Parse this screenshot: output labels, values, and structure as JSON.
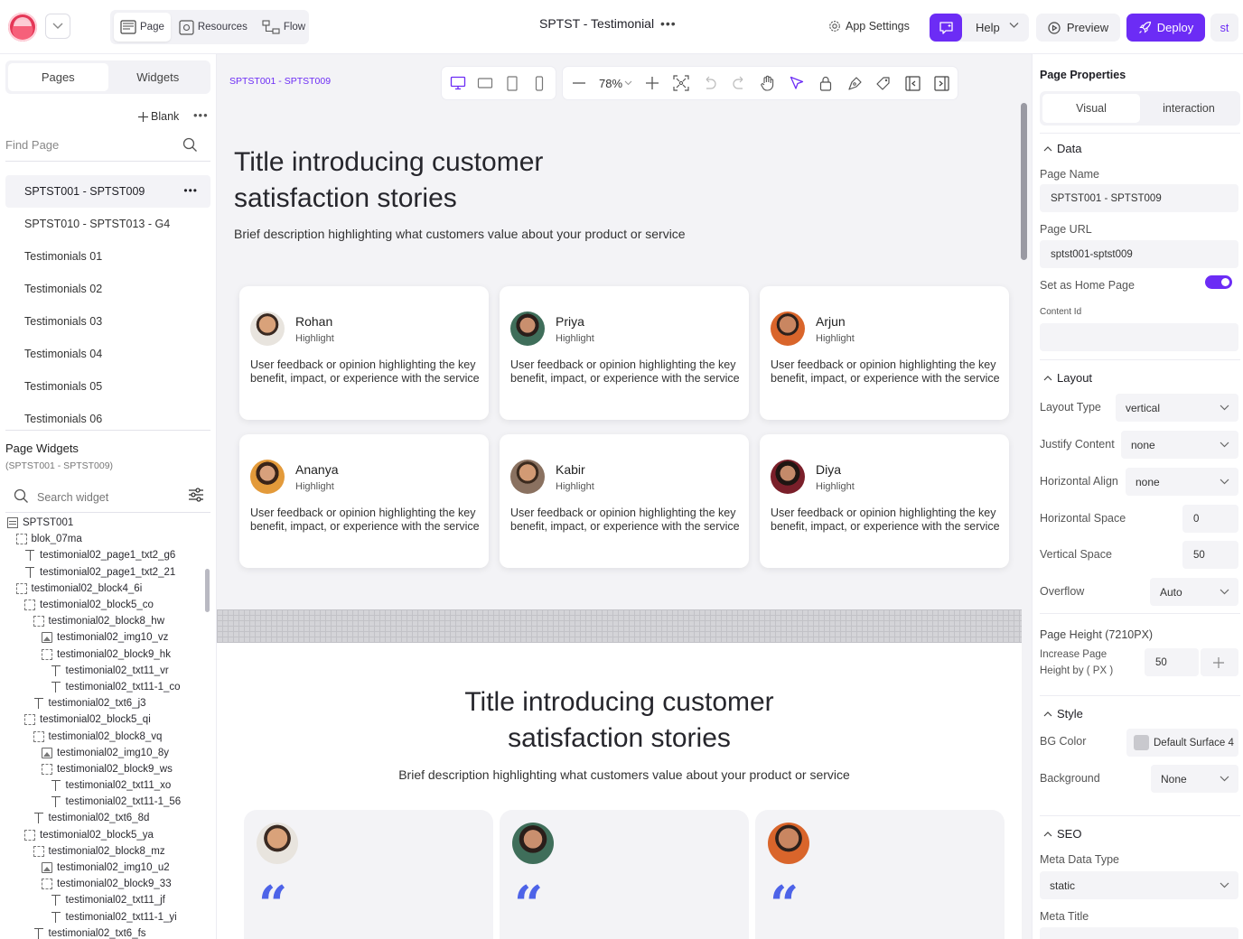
{
  "topbar": {
    "modes": [
      {
        "label": "Page",
        "active": true
      },
      {
        "label": "Resources",
        "active": false
      },
      {
        "label": "Flow",
        "active": false
      }
    ],
    "app_title": "SPTST - Testimonial",
    "title_menu": "•••",
    "app_settings": "App Settings",
    "help": "Help",
    "preview": "Preview",
    "deploy": "Deploy",
    "user_initials": "st",
    "accent_color": "#6c2cf5"
  },
  "left": {
    "tabs": [
      "Pages",
      "Widgets"
    ],
    "active_tab": "Pages",
    "blank_label": "Blank",
    "more": "•••",
    "find_placeholder": "Find Page",
    "pages": [
      {
        "label": "SPTST001 - SPTST009",
        "active": true
      },
      {
        "label": "SPTST010 - SPTST013 - G4",
        "active": false
      },
      {
        "label": "Testimonials 01",
        "active": false
      },
      {
        "label": "Testimonials 02",
        "active": false
      },
      {
        "label": "Testimonials 03",
        "active": false
      },
      {
        "label": "Testimonials 04",
        "active": false
      },
      {
        "label": "Testimonials 05",
        "active": false
      },
      {
        "label": "Testimonials 06",
        "active": false
      }
    ],
    "page_widgets_title": "Page Widgets",
    "page_widgets_sub": "(SPTST001 - SPTST009)",
    "search_widget": "Search widget",
    "tree": [
      {
        "label": "SPTST001",
        "icon": "page",
        "depth": 0
      },
      {
        "label": "blok_07ma",
        "icon": "box",
        "depth": 1
      },
      {
        "label": "testimonial02_page1_txt2_g6",
        "icon": "text",
        "depth": 2
      },
      {
        "label": "testimonial02_page1_txt2_21",
        "icon": "text",
        "depth": 2
      },
      {
        "label": "testimonial02_block4_6i",
        "icon": "box",
        "depth": 1
      },
      {
        "label": "testimonial02_block5_co",
        "icon": "box",
        "depth": 2
      },
      {
        "label": "testimonial02_block8_hw",
        "icon": "box",
        "depth": 3
      },
      {
        "label": "testimonial02_img10_vz",
        "icon": "img",
        "depth": 4
      },
      {
        "label": "testimonial02_block9_hk",
        "icon": "box",
        "depth": 4
      },
      {
        "label": "testimonial02_txt11_vr",
        "icon": "text",
        "depth": 5
      },
      {
        "label": "testimonial02_txt11-1_co",
        "icon": "text",
        "depth": 5
      },
      {
        "label": "testimonial02_txt6_j3",
        "icon": "text",
        "depth": 3
      },
      {
        "label": "testimonial02_block5_qi",
        "icon": "box",
        "depth": 2
      },
      {
        "label": "testimonial02_block8_vq",
        "icon": "box",
        "depth": 3
      },
      {
        "label": "testimonial02_img10_8y",
        "icon": "img",
        "depth": 4
      },
      {
        "label": "testimonial02_block9_ws",
        "icon": "box",
        "depth": 4
      },
      {
        "label": "testimonial02_txt11_xo",
        "icon": "text",
        "depth": 5
      },
      {
        "label": "testimonial02_txt11-1_56",
        "icon": "text",
        "depth": 5
      },
      {
        "label": "testimonial02_txt6_8d",
        "icon": "text",
        "depth": 3
      },
      {
        "label": "testimonial02_block5_ya",
        "icon": "box",
        "depth": 2
      },
      {
        "label": "testimonial02_block8_mz",
        "icon": "box",
        "depth": 3
      },
      {
        "label": "testimonial02_img10_u2",
        "icon": "img",
        "depth": 4
      },
      {
        "label": "testimonial02_block9_33",
        "icon": "box",
        "depth": 4
      },
      {
        "label": "testimonial02_txt11_jf",
        "icon": "text",
        "depth": 5
      },
      {
        "label": "testimonial02_txt11-1_yi",
        "icon": "text",
        "depth": 5
      },
      {
        "label": "testimonial02_txt6_fs",
        "icon": "text",
        "depth": 3
      }
    ]
  },
  "canvas": {
    "page_name": "SPTST001 - SPTST009",
    "zoom": "78%",
    "section1": {
      "title": "Title introducing customer satisfaction stories",
      "description": "Brief description highlighting what customers value about your product or service",
      "cards": [
        {
          "name": "Rohan",
          "highlight": "Highlight",
          "feedback": "User feedback or opinion highlighting the key benefit, impact, or experience with the service"
        },
        {
          "name": "Priya",
          "highlight": "Highlight",
          "feedback": "User feedback or opinion highlighting the key benefit, impact, or experience with the service"
        },
        {
          "name": "Arjun",
          "highlight": "Highlight",
          "feedback": "User feedback or opinion highlighting the key benefit, impact, or experience with the service"
        },
        {
          "name": "Ananya",
          "highlight": "Highlight",
          "feedback": "User feedback or opinion highlighting the key benefit, impact, or experience with the service"
        },
        {
          "name": "Kabir",
          "highlight": "Highlight",
          "feedback": "User feedback or opinion highlighting the key benefit, impact, or experience with the service"
        },
        {
          "name": "Diya",
          "highlight": "Highlight",
          "feedback": "User feedback or opinion highlighting the key benefit, impact, or experience with the service"
        }
      ]
    },
    "section2": {
      "title": "Title introducing customer satisfaction stories",
      "description": "Brief description highlighting what customers value about your product or service",
      "quote_glyph": "“",
      "quote_color": "#4d63e8"
    }
  },
  "right": {
    "title": "Page Properties",
    "tabs": [
      "Visual",
      "interaction"
    ],
    "active_tab": "Visual",
    "data_section": "Data",
    "page_name_label": "Page Name",
    "page_name_value": "SPTST001 - SPTST009",
    "page_url_label": "Page URL",
    "page_url_value": "sptst001-sptst009",
    "home_label": "Set as Home Page",
    "home_on": true,
    "content_id_label": "Content Id",
    "layout_section": "Layout",
    "layout_type_label": "Layout Type",
    "layout_type_value": "vertical",
    "justify_label": "Justify Content",
    "justify_value": "none",
    "halign_label": "Horizontal Align",
    "halign_value": "none",
    "hspace_label": "Horizontal Space",
    "hspace_value": "0",
    "vspace_label": "Vertical Space",
    "vspace_value": "50",
    "overflow_label": "Overflow",
    "overflow_value": "Auto",
    "page_height_label": "Page Height (7210PX)",
    "increase_label": "Increase Page Height by ( PX )",
    "increase_value": "50",
    "style_section": "Style",
    "bgcolor_label": "BG Color",
    "bgcolor_value": "Default Surface 4",
    "background_label": "Background",
    "background_value": "None",
    "seo_section": "SEO",
    "meta_type_label": "Meta Data Type",
    "meta_type_value": "static",
    "meta_title_label": "Meta Title"
  }
}
